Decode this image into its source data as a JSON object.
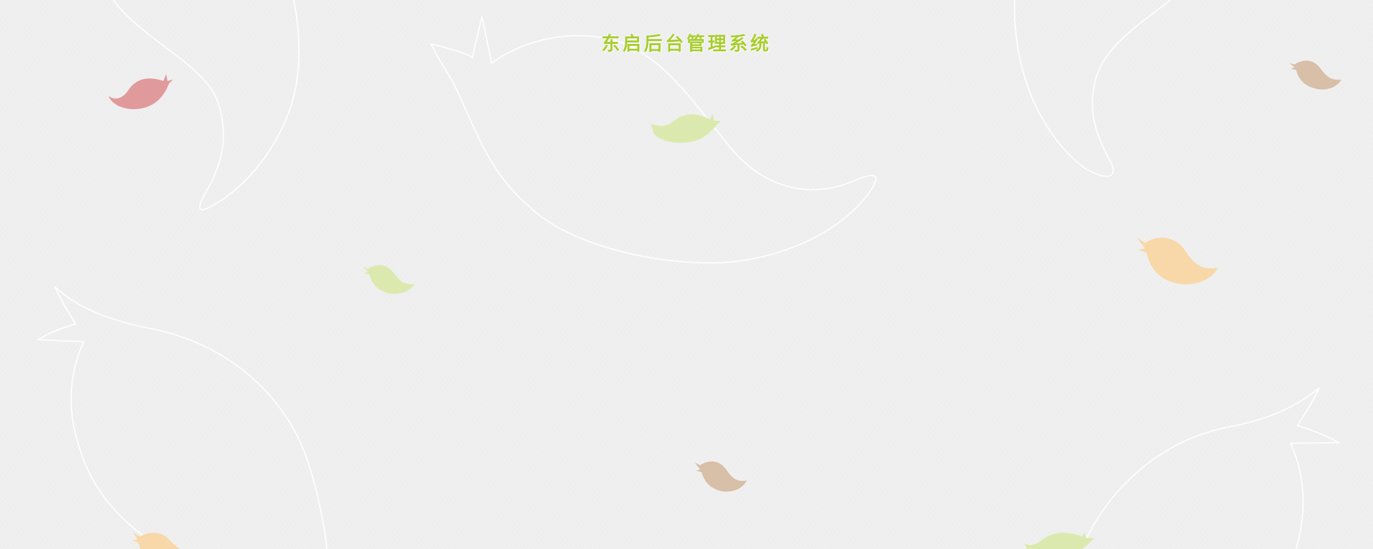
{
  "header": {
    "title": "东启后台管理系统"
  },
  "decorations": {
    "birds": [
      {
        "name": "bird-red",
        "color": "#e09a9c"
      },
      {
        "name": "bird-green-top",
        "color": "#dce9ae"
      },
      {
        "name": "bird-tan-top-right",
        "color": "#d7bfa8"
      },
      {
        "name": "bird-green-small",
        "color": "#dce9ae"
      },
      {
        "name": "bird-orange-right",
        "color": "#f8d8a8"
      },
      {
        "name": "bird-tan-bottom",
        "color": "#d7bfa8"
      },
      {
        "name": "bird-orange-bottom-left",
        "color": "#f8d8a8"
      },
      {
        "name": "bird-green-bottom-right",
        "color": "#dce9ae"
      }
    ],
    "outline_color": "#ffffff",
    "background_color": "#efefef"
  }
}
